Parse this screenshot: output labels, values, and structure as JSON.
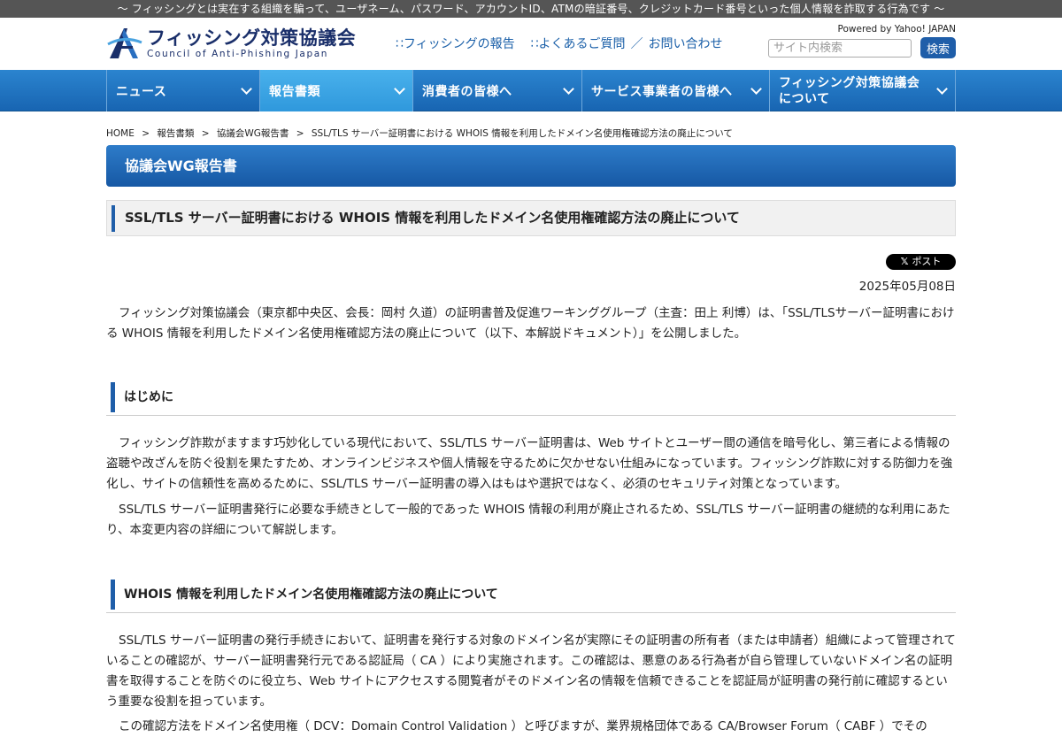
{
  "topbar": {
    "text": "～ フィッシングとは実在する組織を騙って、ユーザネーム、パスワード、アカウントID、ATMの暗証番号、クレジットカード番号といった個人情報を詐取する行為です ～"
  },
  "header": {
    "logo_jp": "フィッシング対策協議会",
    "logo_en": "Council of Anti-Phishing Japan",
    "links": {
      "report": "∷フィッシングの報告",
      "faq": "∷よくあるご質問",
      "sep": "／",
      "contact": "お問い合わせ"
    },
    "powered": "Powered by Yahoo! JAPAN",
    "search_placeholder": "サイト内検索",
    "search_button": "検索"
  },
  "nav": {
    "items": [
      {
        "label": "ニュース"
      },
      {
        "label": "報告書類"
      },
      {
        "label": "消費者の皆様へ"
      },
      {
        "label": "サービス事業者の皆様へ"
      },
      {
        "label_line1": "フィッシング対策協議会",
        "label_line2": "について"
      }
    ]
  },
  "breadcrumb": {
    "home": "HOME",
    "sep": ">",
    "c1": "報告書類",
    "c2": "協議会WG報告書",
    "c3": "SSL/TLS サーバー証明書における WHOIS 情報を利用したドメイン名使用権確認方法の廃止について"
  },
  "section_title": "協議会WG報告書",
  "article": {
    "title": "SSL/TLS サーバー証明書における WHOIS 情報を利用したドメイン名使用権確認方法の廃止について",
    "post_x": "𝕏",
    "post_label": "ポスト",
    "date": "2025年05月08日",
    "intro": "フィッシング対策協議会（東京都中央区、会長：岡村 久道）の証明書普及促進ワーキンググループ（主査：田上 利博）は、「SSL/TLSサーバー証明書における WHOIS 情報を利用したドメイン名使用権確認方法の廃止について（以下、本解説ドキュメント）」を公開しました。",
    "h_intro": "はじめに",
    "p1": "フィッシング詐欺がますます巧妙化している現代において、SSL/TLS サーバー証明書は、Web サイトとユーザー間の通信を暗号化し、第三者による情報の盗聴や改ざんを防ぐ役割を果たすため、オンラインビジネスや個人情報を守るために欠かせない仕組みになっています。フィッシング詐欺に対する防御力を強化し、サイトの信頼性を高めるために、SSL/TLS サーバー証明書の導入はもはや選択ではなく、必須のセキュリティ対策となっています。",
    "p2": "SSL/TLS サーバー証明書発行に必要な手続きとして一般的であった WHOIS 情報の利用が廃止されるため、SSL/TLS サーバー証明書の継続的な利用にあたり、本変更内容の詳細について解説します。",
    "h_whois": "WHOIS 情報を利用したドメイン名使用権確認方法の廃止について",
    "p3": "SSL/TLS サーバー証明書の発行手続きにおいて、証明書を発行する対象のドメイン名が実際にその証明書の所有者（または申請者）組織によって管理されていることの確認が、サーバー証明書発行元である認証局（ CA ）により実施されます。この確認は、悪意のある行為者が自ら管理していないドメイン名の証明書を取得することを防ぐのに役立ち、Web サイトにアクセスする閲覧者がそのドメイン名の情報を信頼できることを認証局が証明書の発行前に確認するという重要な役割を担っています。",
    "p4": "この確認方法をドメイン名使用権（ DCV：Domain Control Validation ）と呼びますが、業界規格団体である CA/Browser Forum（ CABF ）でその"
  },
  "colors": {
    "brand_blue": "#1f5ea9",
    "nav_active": "#3aa3e3",
    "topbar": "#555555"
  }
}
